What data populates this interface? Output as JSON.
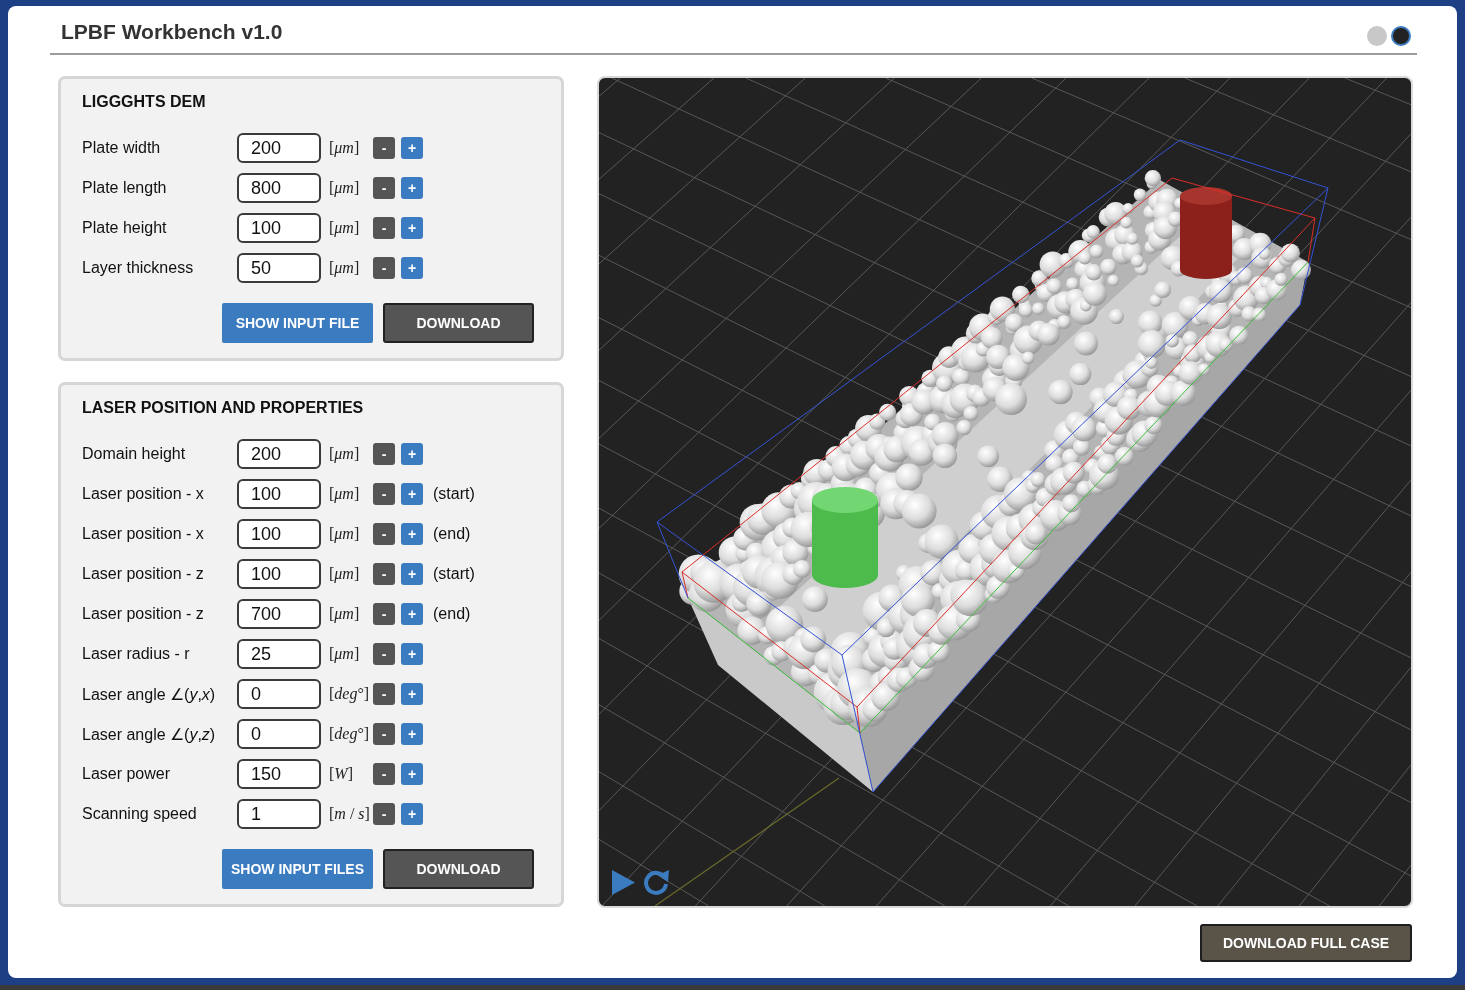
{
  "window": {
    "title": "LPBF Workbench v1.0"
  },
  "view_dots": [
    {
      "selected": false
    },
    {
      "selected": true
    }
  ],
  "panels": [
    {
      "title": "LIGGGHTS DEM",
      "rows": [
        {
          "label": "Plate width",
          "value": "200",
          "unit": "[*μm*]",
          "decrement": "-",
          "increment": "+"
        },
        {
          "label": "Plate length",
          "value": "800",
          "unit": "[*μm*]",
          "decrement": "-",
          "increment": "+"
        },
        {
          "label": "Plate height",
          "value": "100",
          "unit": "[*μm*]",
          "decrement": "-",
          "increment": "+"
        },
        {
          "label": "Layer thickness",
          "value": "50",
          "unit": "[*μm*]",
          "decrement": "-",
          "increment": "+"
        }
      ],
      "buttons": [
        {
          "label": "SHOW INPUT FILE",
          "kind": "primary"
        },
        {
          "label": "DOWNLOAD",
          "kind": "secondary"
        }
      ]
    },
    {
      "title": "LASER POSITION AND PROPERTIES",
      "rows": [
        {
          "label": "Domain height",
          "value": "200",
          "unit": "[*μm*]",
          "decrement": "-",
          "increment": "+"
        },
        {
          "label": "Laser position - x",
          "value": "100",
          "unit": "[*μm*]",
          "decrement": "-",
          "increment": "+",
          "note": "(start)"
        },
        {
          "label": "Laser position - x",
          "value": "100",
          "unit": "[*μm*]",
          "decrement": "-",
          "increment": "+",
          "note": "(end)"
        },
        {
          "label": "Laser position - z",
          "value": "100",
          "unit": "[*μm*]",
          "decrement": "-",
          "increment": "+",
          "note": "(start)"
        },
        {
          "label": "Laser position - z",
          "value": "700",
          "unit": "[*μm*]",
          "decrement": "-",
          "increment": "+",
          "note": "(end)"
        },
        {
          "label": "Laser radius - r",
          "value": "25",
          "unit": "[*μm*]",
          "decrement": "-",
          "increment": "+"
        },
        {
          "label": "Laser angle ∠(*y*,*x*)",
          "value": "0",
          "unit": "[*deg*°]",
          "decrement": "-",
          "increment": "+"
        },
        {
          "label": "Laser angle ∠(*y*,*z*)",
          "value": "0",
          "unit": "[*deg*°]",
          "decrement": "-",
          "increment": "+"
        },
        {
          "label": "Laser power",
          "value": "150",
          "unit": "[*W*]",
          "decrement": "-",
          "increment": "+"
        },
        {
          "label": "Scanning speed",
          "value": "1",
          "unit": "[*m* / *s*]",
          "decrement": "-",
          "increment": "+"
        }
      ],
      "buttons": [
        {
          "label": "SHOW INPUT FILES",
          "kind": "primary"
        },
        {
          "label": "DOWNLOAD",
          "kind": "secondary"
        }
      ]
    }
  ],
  "footer": {
    "button": "DOWNLOAD FULL CASE"
  }
}
